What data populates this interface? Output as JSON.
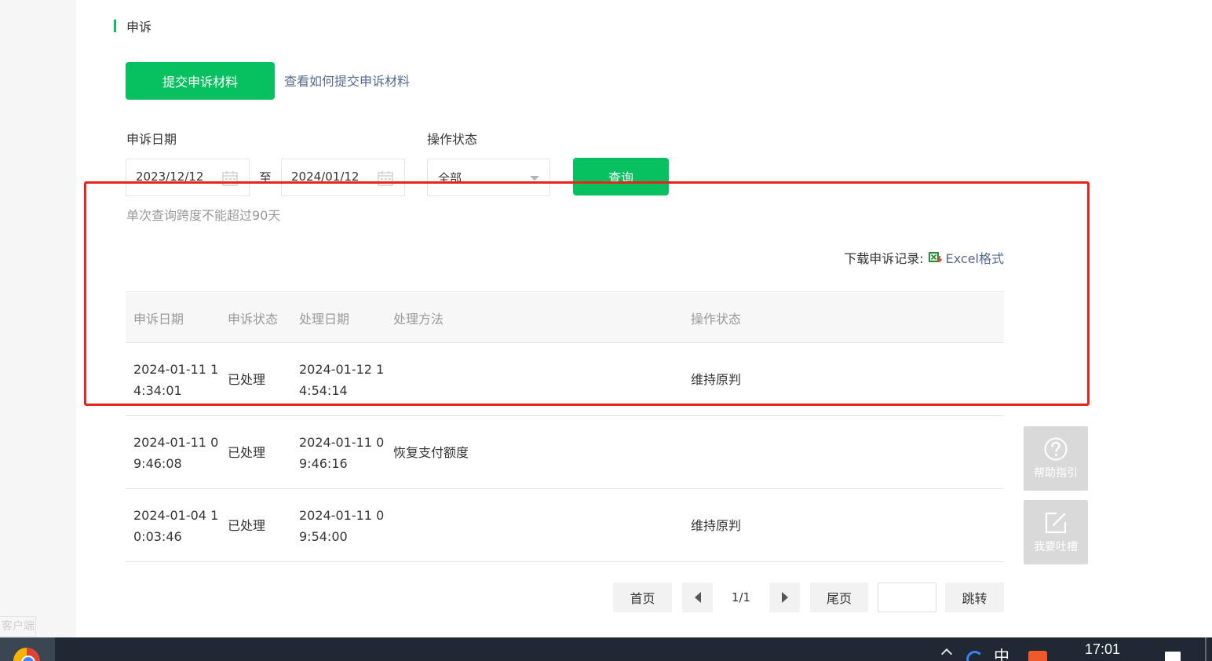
{
  "gutter": {
    "text": "客户端"
  },
  "section": {
    "title": "申诉"
  },
  "actions": {
    "submit_label": "提交申诉材料",
    "howto_link": "查看如何提交申诉材料"
  },
  "filters": {
    "date_label": "申诉日期",
    "date_from": "2023/12/12",
    "date_sep": "至",
    "date_to": "2024/01/12",
    "status_label": "操作状态",
    "status_value": "全部",
    "query_label": "查询",
    "hint": "单次查询跨度不能超过90天"
  },
  "download": {
    "label": "下载申诉记录:",
    "link": "Excel格式"
  },
  "table": {
    "headers": [
      "申诉日期",
      "申诉状态",
      "处理日期",
      "处理方法",
      "操作状态"
    ],
    "rows": [
      {
        "appeal_date": "2024-01-11 14:34:01",
        "status": "已处理",
        "handle_date": "2024-01-12 14:54:14",
        "method": "",
        "op_status": "维持原判"
      },
      {
        "appeal_date": "2024-01-11 09:46:08",
        "status": "已处理",
        "handle_date": "2024-01-11 09:46:16",
        "method": "恢复支付额度",
        "op_status": ""
      },
      {
        "appeal_date": "2024-01-04 10:03:46",
        "status": "已处理",
        "handle_date": "2024-01-11 09:54:00",
        "method": "",
        "op_status": "维持原判"
      }
    ]
  },
  "pagination": {
    "first": "首页",
    "info": "1/1",
    "last": "尾页",
    "jump": "跳转",
    "jump_value": ""
  },
  "float": {
    "help": "帮助指引",
    "feedback": "我要吐槽"
  },
  "taskbar": {
    "ime": "中",
    "time": "17:01"
  },
  "colors": {
    "accent": "#07c160",
    "link": "#576b95",
    "annotation": "#e8231c"
  }
}
